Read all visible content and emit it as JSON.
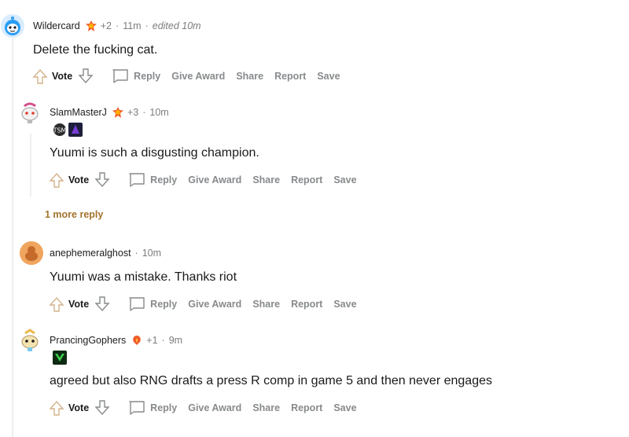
{
  "comments": [
    {
      "username": "Wildercard",
      "points": "+2",
      "time": "11m",
      "edited": "edited 10m",
      "body": "Delete the fucking cat."
    },
    {
      "username": "SlamMasterJ",
      "points": "+3",
      "time": "10m",
      "body": "Yuumi is such a disgusting champion."
    },
    {
      "username": "anephemeralghost",
      "time": "10m",
      "body": "Yuumi was a mistake. Thanks riot"
    },
    {
      "username": "PrancingGophers",
      "points": "+1",
      "time": "9m",
      "body": "agreed but also RNG drafts a press R comp in game 5 and then never engages"
    }
  ],
  "actions": {
    "vote": "Vote",
    "reply": "Reply",
    "give_award": "Give Award",
    "share": "Share",
    "report": "Report",
    "save": "Save"
  },
  "more_replies": "1 more reply",
  "separator": "·",
  "colors": {
    "text": "#1a1a1b",
    "muted": "#7c7c7c",
    "action": "#878a8c",
    "more_reply": "#a4732e",
    "thread_line": "#edeff1"
  }
}
